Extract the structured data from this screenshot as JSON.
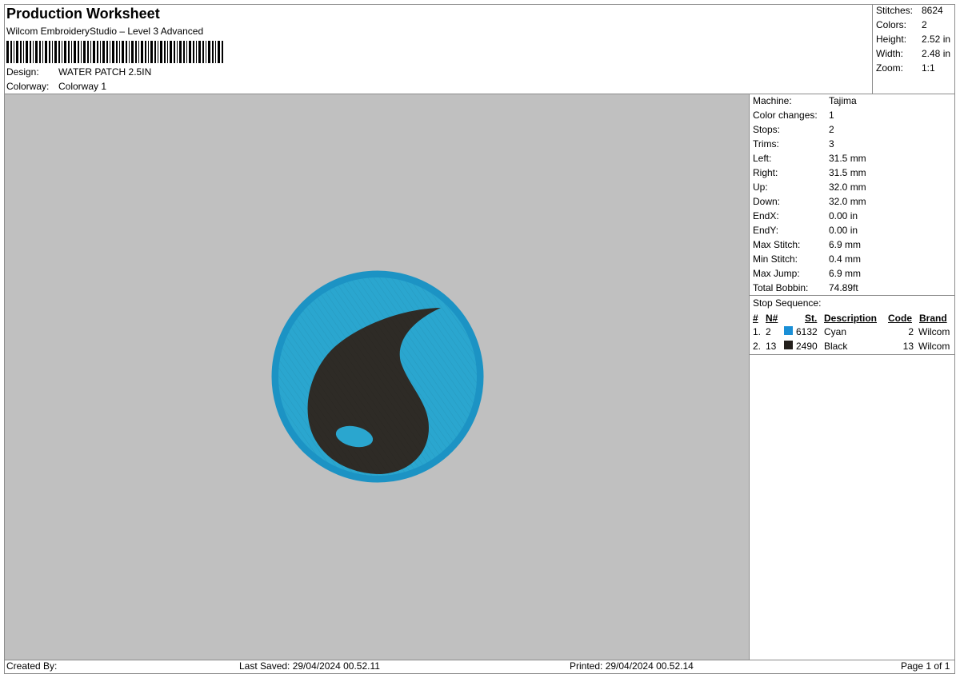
{
  "header": {
    "title": "Production Worksheet",
    "software": "Wilcom EmbroideryStudio – Level 3 Advanced",
    "design_label": "Design:",
    "design_value": "WATER PATCH 2.5IN",
    "colorway_label": "Colorway:",
    "colorway_value": "Colorway 1"
  },
  "summary": {
    "stitches_label": "Stitches:",
    "stitches": "8624",
    "colors_label": "Colors:",
    "colors": "2",
    "height_label": "Height:",
    "height": "2.52 in",
    "width_label": "Width:",
    "width": "2.48 in",
    "zoom_label": "Zoom:",
    "zoom": "1:1"
  },
  "machine": [
    {
      "label": "Machine:",
      "value": "Tajima"
    },
    {
      "label": "Color changes:",
      "value": "1"
    },
    {
      "label": "Stops:",
      "value": "2"
    },
    {
      "label": "Trims:",
      "value": "3"
    },
    {
      "label": "Left:",
      "value": "31.5 mm"
    },
    {
      "label": "Right:",
      "value": "31.5 mm"
    },
    {
      "label": "Up:",
      "value": "32.0 mm"
    },
    {
      "label": "Down:",
      "value": "32.0 mm"
    },
    {
      "label": "EndX:",
      "value": "0.00 in"
    },
    {
      "label": "EndY:",
      "value": "0.00 in"
    },
    {
      "label": "Max Stitch:",
      "value": "6.9 mm"
    },
    {
      "label": "Min Stitch:",
      "value": "0.4 mm"
    },
    {
      "label": "Max Jump:",
      "value": "6.9 mm"
    },
    {
      "label": "Total Bobbin:",
      "value": "74.89ft"
    }
  ],
  "stop_sequence": {
    "title": "Stop Sequence:",
    "headers": {
      "num": "#",
      "n": "N#",
      "st": "St.",
      "description": "Description",
      "code": "Code",
      "brand": "Brand"
    },
    "rows": [
      {
        "num": "1.",
        "n": "2",
        "color": "#1a8fd6",
        "st": "6132",
        "description": "Cyan",
        "code": "2",
        "brand": "Wilcom"
      },
      {
        "num": "2.",
        "n": "13",
        "color": "#231f1c",
        "st": "2490",
        "description": "Black",
        "code": "13",
        "brand": "Wilcom"
      }
    ]
  },
  "design_colors": {
    "background": "#c0c0c0",
    "patch_fill": "#2aa6cf",
    "patch_border": "#1c93c4",
    "drop": "#2e2b26"
  },
  "footer": {
    "created_by": "Created By:",
    "last_saved": "Last Saved: 29/04/2024 00.52.11",
    "printed": "Printed: 29/04/2024 00.52.14",
    "page": "Page 1 of 1"
  }
}
